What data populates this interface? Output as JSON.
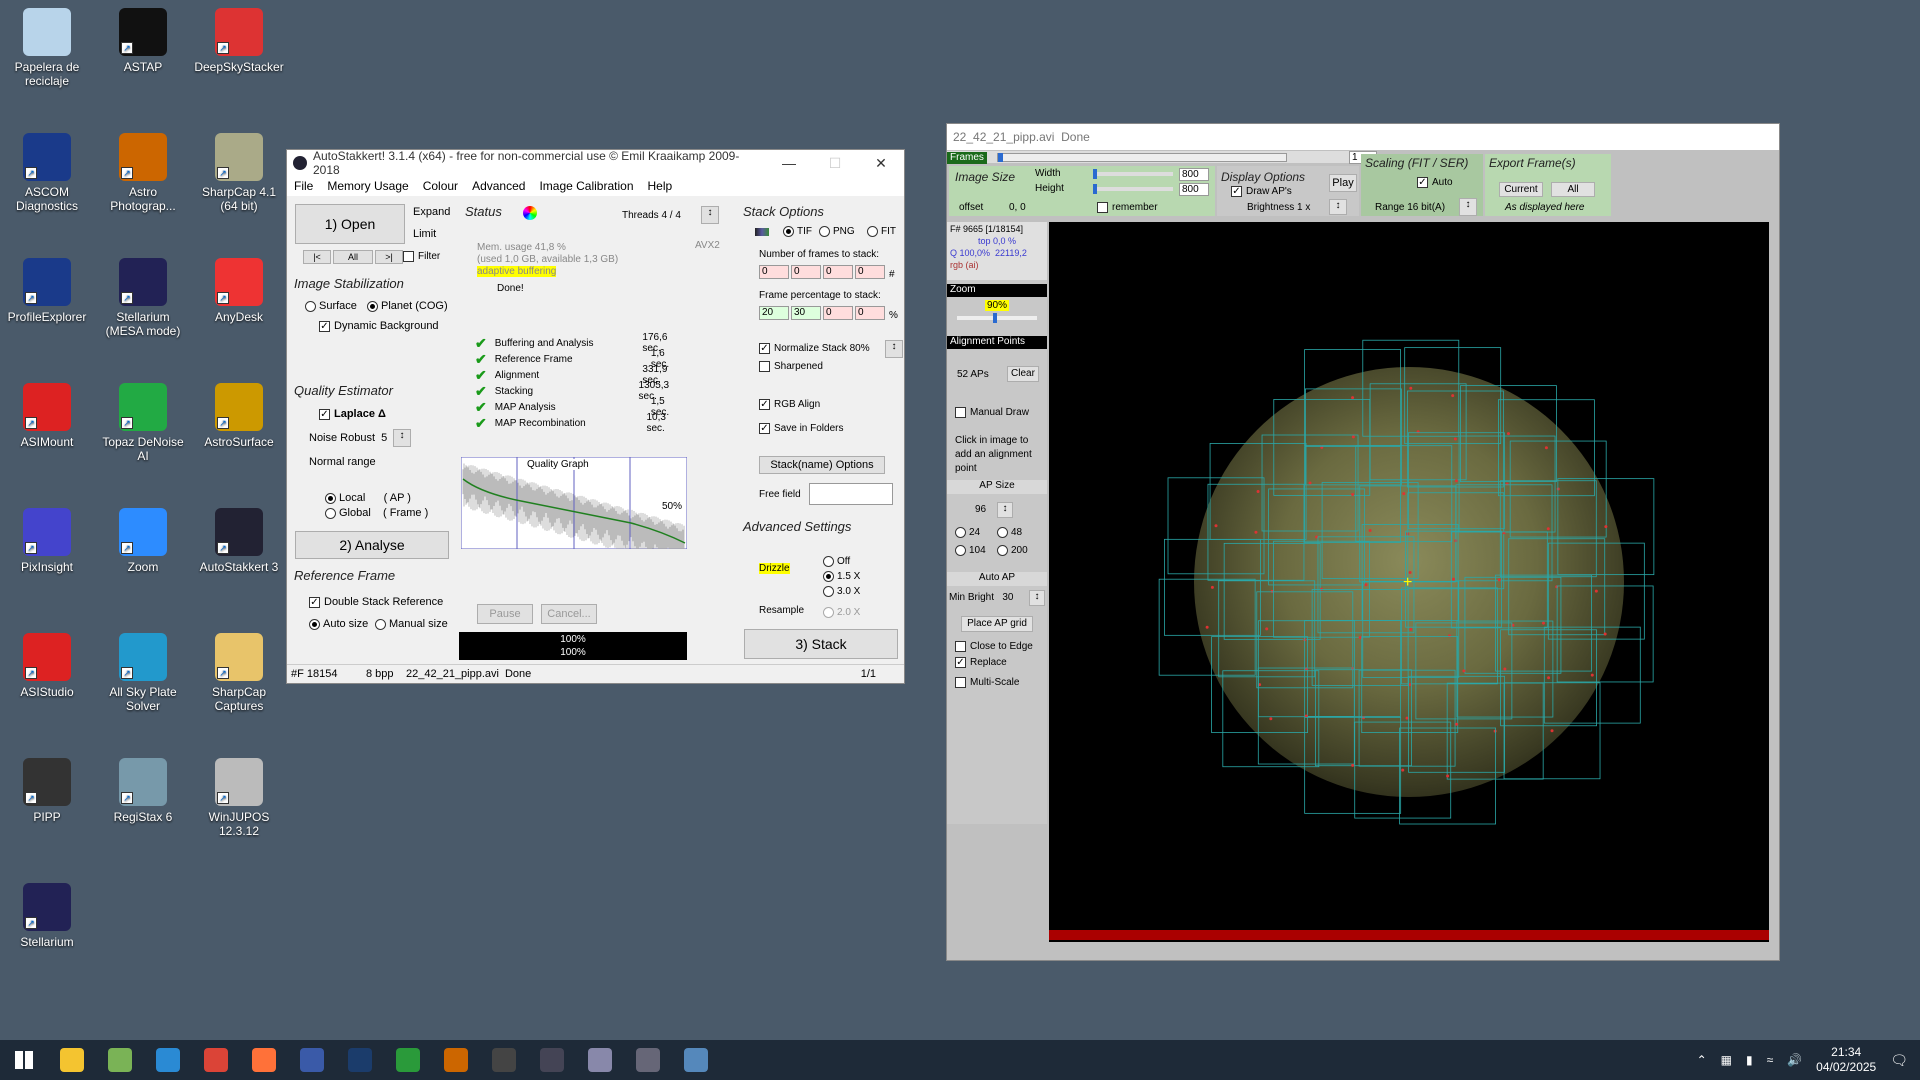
{
  "desktop": {
    "icons": [
      {
        "label": "Papelera de reciclaje",
        "icon": "recycle-bin-icon",
        "color": "#b8d4ea"
      },
      {
        "label": "ASTAP",
        "icon": "astap-icon",
        "color": "#111"
      },
      {
        "label": "DeepSkyStacker",
        "icon": "deepskystacker-icon",
        "color": "#d33"
      },
      {
        "label": "ASCOM Diagnostics",
        "icon": "ascom-icon",
        "color": "#1a3a8a"
      },
      {
        "label": "Astro Photograp...",
        "icon": "astro-photography-icon",
        "color": "#c60"
      },
      {
        "label": "SharpCap 4.1 (64 bit)",
        "icon": "sharpcap-icon",
        "color": "#aa8"
      },
      {
        "label": "ProfileExplorer",
        "icon": "profileexplorer-icon",
        "color": "#1a3a8a"
      },
      {
        "label": "Stellarium (MESA mode)",
        "icon": "stellarium-icon",
        "color": "#225"
      },
      {
        "label": "AnyDesk",
        "icon": "anydesk-icon",
        "color": "#e33"
      },
      {
        "label": "ASIMount",
        "icon": "asimount-icon",
        "color": "#d22"
      },
      {
        "label": "Topaz DeNoise AI",
        "icon": "topaz-icon",
        "color": "#2a4"
      },
      {
        "label": "AstroSurface",
        "icon": "astrosurface-icon",
        "color": "#c90"
      },
      {
        "label": "PixInsight",
        "icon": "pixinsight-icon",
        "color": "#44c"
      },
      {
        "label": "Zoom",
        "icon": "zoom-icon",
        "color": "#2d8cff"
      },
      {
        "label": "AutoStakkert 3",
        "icon": "autostakkert-icon",
        "color": "#223"
      },
      {
        "label": "ASIStudio",
        "icon": "asistudio-icon",
        "color": "#d22"
      },
      {
        "label": "All Sky Plate Solver",
        "icon": "plate-solver-icon",
        "color": "#29c"
      },
      {
        "label": "SharpCap Captures",
        "icon": "folder-icon",
        "color": "#e8c46a"
      },
      {
        "label": "PIPP",
        "icon": "pipp-icon",
        "color": "#333"
      },
      {
        "label": "RegiStax 6",
        "icon": "registax-icon",
        "color": "#79a"
      },
      {
        "label": "WinJUPOS 12.3.12",
        "icon": "winjupos-icon",
        "color": "#bbb"
      },
      {
        "label": "Stellarium",
        "icon": "stellarium-icon",
        "color": "#225"
      }
    ]
  },
  "as": {
    "title": "AutoStakkert! 3.1.4 (x64) - free for non-commercial use © Emil Kraaikamp 2009-2018",
    "menu": [
      "File",
      "Memory Usage",
      "Colour",
      "Advanced",
      "Image Calibration",
      "Help"
    ],
    "open": "1) Open",
    "expand": "Expand",
    "limit": "Limit",
    "nav": [
      "|<",
      "All",
      ">|"
    ],
    "filter": "Filter",
    "img_stab": "Image Stabilization",
    "surface": "Surface",
    "planet": "Planet (COG)",
    "dyn_bg": "Dynamic Background",
    "quality": "Quality Estimator",
    "laplace": "Laplace Δ",
    "noise": "Noise Robust",
    "noise_val": "5",
    "normal_range": "Normal range",
    "local": "Local",
    "local_ap": "( AP )",
    "global": "Global",
    "global_frame": "( Frame )",
    "analyse": "2) Analyse",
    "ref_frame": "Reference Frame",
    "double_stack": "Double Stack Reference",
    "auto_size": "Auto size",
    "manual_size": "Manual size",
    "status": "Status",
    "threads": "Threads 4 / 4",
    "avx": "AVX2",
    "mem1": "Mem. usage 41,8 %",
    "mem2": "(used 1,0 GB, available 1,3 GB)",
    "adaptive": "adaptive buffering",
    "done": "Done!",
    "steps": [
      {
        "label": "Buffering and Analysis",
        "time": "176,6 sec."
      },
      {
        "label": "Reference Frame",
        "time": "1,6 sec."
      },
      {
        "label": "Alignment",
        "time": "331,9 sec."
      },
      {
        "label": "Stacking",
        "time": "1305,3 sec."
      },
      {
        "label": "MAP Analysis",
        "time": "1,5 sec."
      },
      {
        "label": "MAP Recombination",
        "time": "10,3 sec."
      }
    ],
    "graph_title": "Quality Graph",
    "graph_pct": "50%",
    "pause": "Pause",
    "cancel": "Cancel...",
    "prog1": "100%",
    "prog2": "100%",
    "stack_options": "Stack Options",
    "tif": "TIF",
    "png": "PNG",
    "fit": "FIT",
    "nframes": "Number of frames to stack:",
    "frames": [
      "0",
      "0",
      "0",
      "0"
    ],
    "hash": "#",
    "pctlabel": "Frame percentage to stack:",
    "pcts": [
      "20",
      "30",
      "0",
      "0"
    ],
    "pctsign": "%",
    "normalize": "Normalize Stack 80%",
    "sharpened": "Sharpened",
    "rgb_align": "RGB Align",
    "save_folders": "Save in Folders",
    "stackname": "Stack(name) Options",
    "free_field": "Free field",
    "adv": "Advanced Settings",
    "drizzle": "Drizzle",
    "off": "Off",
    "x15": "1.5 X",
    "x30": "3.0 X",
    "resample": "Resample",
    "x20": "2.0 X",
    "stack": "3) Stack",
    "sb": [
      "#F 18154",
      "8 bpp",
      "22_42_21_pipp.avi",
      "Done",
      "1/1"
    ]
  },
  "fw": {
    "title": "22_42_21_pipp.avi",
    "title_status": "Done",
    "frames": "Frames",
    "frame_no": "1",
    "image_size": "Image Size",
    "width": "Width",
    "height": "Height",
    "w_val": "800",
    "h_val": "800",
    "offset": "offset",
    "offset_val": "0, 0",
    "remember": "remember",
    "display": "Display Options",
    "draw_aps": "Draw AP's",
    "brightness": "Brightness 1 x",
    "play": "Play",
    "scaling": "Scaling (FIT / SER)",
    "auto": "Auto",
    "range": "Range 16 bit(A)",
    "export": "Export Frame(s)",
    "current": "Current",
    "all": "All",
    "as_displayed": "As displayed here",
    "info1": "F# 9665 [1/18154]",
    "info2": "top 0,0 %",
    "info3": "Q 100,0%",
    "info3b": "22119,2",
    "info4": "rgb (ai)",
    "zoom": "Zoom",
    "zoom_val": "90%",
    "ap_header": "Alignment Points",
    "aps": "52 APs",
    "clear": "Clear",
    "manual_draw": "Manual Draw",
    "click_hint": "Click in image to add an alignment point",
    "ap_size": "AP Size",
    "ap_size_val": "96",
    "sizes": [
      "24",
      "48",
      "104",
      "200"
    ],
    "auto_ap": "Auto AP",
    "min_bright": "Min Bright",
    "min_bright_val": "30",
    "place_grid": "Place AP grid",
    "close_edge": "Close to Edge",
    "replace": "Replace",
    "multi_scale": "Multi-Scale",
    "frame_pos": 0.0
  },
  "taskbar": {
    "time": "21:34",
    "date": "04/02/2025",
    "apps": [
      {
        "name": "file-explorer-icon",
        "color": "#f4c430"
      },
      {
        "name": "notepad-icon",
        "color": "#7ab356"
      },
      {
        "name": "vscode-icon",
        "color": "#2a8ad4"
      },
      {
        "name": "chrome-icon",
        "color": "#db4437"
      },
      {
        "name": "firefox-icon",
        "color": "#ff7139"
      },
      {
        "name": "ascom-app-icon",
        "color": "#3a5aa8"
      },
      {
        "name": "lightroom-icon",
        "color": "#1b3c6b"
      },
      {
        "name": "gps-icon",
        "color": "#2a9a3a"
      },
      {
        "name": "astro-app-icon",
        "color": "#c60"
      },
      {
        "name": "pipp-app-icon",
        "color": "#444"
      },
      {
        "name": "autostakkert-app-icon",
        "color": "#445"
      },
      {
        "name": "paint-icon",
        "color": "#88a"
      },
      {
        "name": "camera-app-icon",
        "color": "#667"
      },
      {
        "name": "window-app-icon",
        "color": "#58b"
      }
    ]
  }
}
